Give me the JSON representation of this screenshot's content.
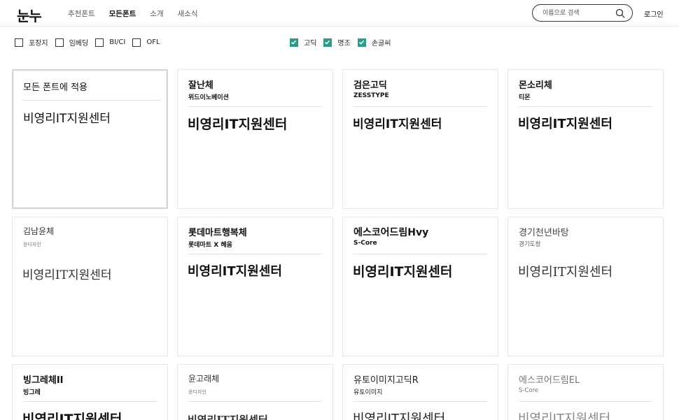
{
  "header": {
    "logo": "눈누",
    "nav": [
      "추천폰트",
      "모든폰트",
      "소개",
      "새소식"
    ],
    "active_nav": "모든폰트",
    "search_placeholder": "이름으로 검색",
    "login": "로그인"
  },
  "filters": {
    "license": [
      {
        "label": "포장지",
        "checked": false
      },
      {
        "label": "임베딩",
        "checked": false
      },
      {
        "label": "BI/CI",
        "checked": false
      },
      {
        "label": "OFL",
        "checked": false
      }
    ],
    "style": [
      {
        "label": "고딕",
        "checked": true
      },
      {
        "label": "명조",
        "checked": true
      },
      {
        "label": "손글씨",
        "checked": true
      }
    ]
  },
  "apply_card": {
    "label": "모든 폰트에 적용",
    "sample_text": "비영리IT지원센터"
  },
  "fonts": [
    {
      "name": "잘난체",
      "maker": "위드이노베이션",
      "sample": "비영리IT지원센터"
    },
    {
      "name": "검은고딕",
      "maker": "ZESSTYPE",
      "sample": "비영리IT지원센터"
    },
    {
      "name": "몬소리체",
      "maker": "티몬",
      "sample": "비영리IT지원센터"
    },
    {
      "name": "김남윤체",
      "maker": "윤디자인",
      "sample": "비영리IT지원센터"
    },
    {
      "name": "롯데마트행복체",
      "maker": "롯데마트 X 혜움",
      "sample": "비영리IT지원센터"
    },
    {
      "name": "에스코어드림Hvy",
      "maker": "S-Core",
      "sample": "비영리IT지원센터"
    },
    {
      "name": "경기천년바탕",
      "maker": "경기도청",
      "sample": "비영리IT지원센터"
    },
    {
      "name": "빙그레체II",
      "maker": "빙그레",
      "sample": "비영리IT지원센터"
    },
    {
      "name": "윤고래체",
      "maker": "윤디자인",
      "sample": "비영리IT지원센터"
    },
    {
      "name": "유토이미지고딕R",
      "maker": "유토이미지",
      "sample": "비영리IT지원센터"
    },
    {
      "name": "에스코어드림EL",
      "maker": "S-Core",
      "sample": "비영리IT지원센터"
    }
  ],
  "colors": {
    "accent": "#2a9c8c"
  }
}
